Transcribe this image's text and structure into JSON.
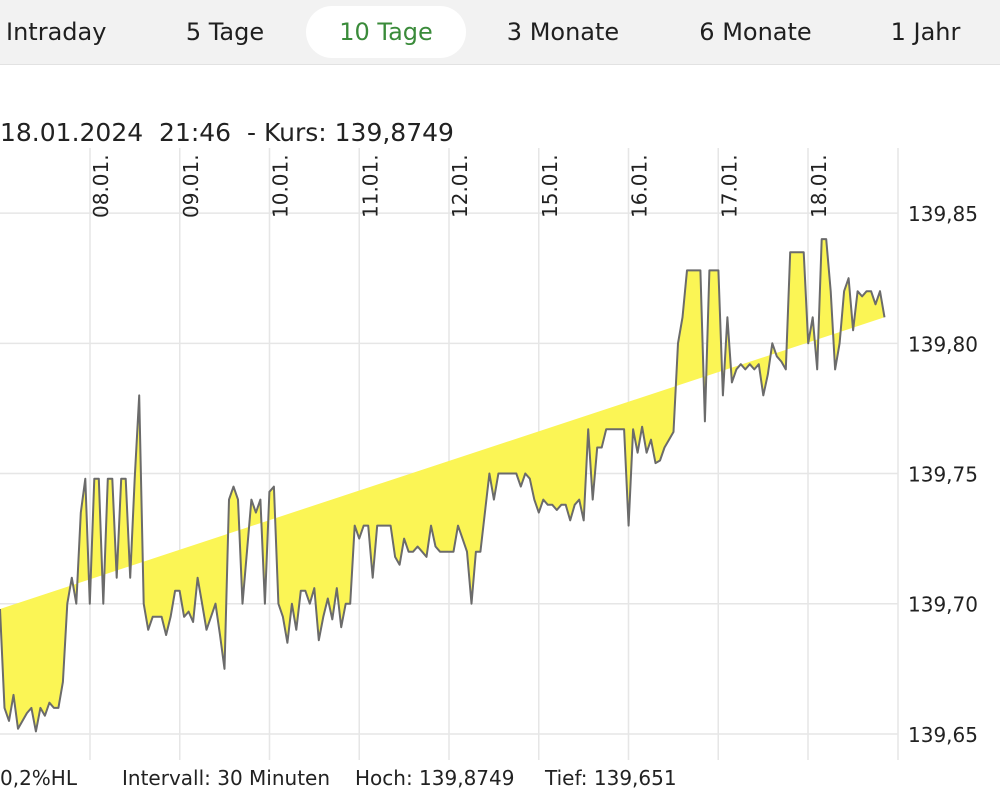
{
  "tabs": [
    {
      "label": "Intraday",
      "active": false
    },
    {
      "label": "5 Tage",
      "active": false
    },
    {
      "label": "10 Tage",
      "active": true
    },
    {
      "label": "3 Monate",
      "active": false
    },
    {
      "label": "6 Monate",
      "active": false
    },
    {
      "label": "1 Jahr",
      "active": false
    }
  ],
  "header": {
    "date": "18.01.2024",
    "time": "21:46",
    "price_label": "- Kurs: 139,8749"
  },
  "footer": {
    "indicator": "0,2%HL",
    "interval": "Intervall: 30 Minuten",
    "high": "Hoch: 139,8749",
    "low": "Tief:  139,651"
  },
  "colors": {
    "area_fill": "#fbf555",
    "line": "#6b6b6b",
    "grid": "#e6e6e6",
    "active_tab_text": "#3a8b3a"
  },
  "chart_data": {
    "type": "area",
    "ylim": [
      139.64,
      139.875
    ],
    "y_ticks": [
      139.65,
      139.7,
      139.75,
      139.8,
      139.85
    ],
    "y_tick_labels": [
      "139,65",
      "139,70",
      "139,75",
      "139,80",
      "139,85"
    ],
    "date_labels": [
      "08.01.",
      "09.01.",
      "10.01.",
      "11.01.",
      "12.01.",
      "15.01.",
      "16.01.",
      "17.01.",
      "18.01."
    ],
    "x": [
      0,
      0.5,
      1,
      1.5,
      2,
      3,
      3.5,
      4,
      4.5,
      5,
      5.5,
      6,
      6.5,
      7,
      7.5,
      8,
      8.5,
      9,
      9.5,
      10,
      10.5,
      11,
      11.5,
      12,
      12.5,
      13,
      13.5,
      14,
      14.5,
      15,
      15.5,
      16,
      16.5,
      17,
      18,
      18.5,
      19,
      19.5,
      20,
      20.5,
      21,
      21.5,
      22,
      22.5,
      23,
      23.5,
      24,
      24.5,
      25,
      25.5,
      26,
      26.5,
      27,
      28,
      28.5,
      29,
      29.5,
      30,
      30.5,
      31,
      31.5,
      32,
      32.5,
      33,
      33.5,
      34,
      34.5,
      35,
      35.5,
      36,
      36.5,
      37,
      37.5,
      38,
      38.5,
      39,
      39.5,
      40,
      40.5,
      41,
      41.5,
      42,
      42.5,
      43,
      43.5,
      44,
      44.5,
      45,
      45.5,
      46,
      46.5,
      47,
      47.5,
      48,
      48.5,
      49,
      50,
      50.5,
      51,
      51.5,
      52,
      52.5,
      53,
      53.5,
      54,
      54.5,
      55,
      55.5,
      56,
      56.5,
      57,
      57.5,
      58,
      58.5,
      59,
      59.5,
      60,
      60.5,
      61,
      61.5,
      62,
      62.5,
      63,
      63.5,
      64,
      64.5,
      65,
      65.5,
      66,
      66.5,
      67,
      67.5,
      68,
      68.5,
      69,
      69.5,
      70,
      70.5,
      71,
      71.5,
      72,
      72.5,
      73,
      73.5,
      74,
      74.5,
      75,
      75.5,
      76,
      76.5,
      77,
      77.5,
      78,
      78.5,
      79,
      79.5,
      80,
      80.5,
      81,
      81.5,
      82,
      82.5,
      83,
      83.5,
      84,
      84.5,
      85,
      85.5,
      86,
      86.5,
      87,
      87.5,
      88,
      88.5,
      89,
      89.5,
      90,
      90.5,
      91,
      91.5,
      92,
      92.5,
      93,
      93.5,
      94,
      94.5,
      95,
      95.5,
      96,
      96.5,
      97,
      97.5,
      98,
      98.5,
      99,
      99.5,
      100
    ],
    "y": [
      139.698,
      139.66,
      139.655,
      139.665,
      139.652,
      139.658,
      139.66,
      139.651,
      139.66,
      139.657,
      139.662,
      139.66,
      139.66,
      139.67,
      139.7,
      139.71,
      139.7,
      139.735,
      139.748,
      139.7,
      139.748,
      139.748,
      139.7,
      139.748,
      139.748,
      139.71,
      139.748,
      139.748,
      139.71,
      139.748,
      139.78,
      139.7,
      139.69,
      139.695,
      139.695,
      139.688,
      139.695,
      139.705,
      139.705,
      139.695,
      139.697,
      139.693,
      139.71,
      139.7,
      139.69,
      139.695,
      139.7,
      139.688,
      139.675,
      139.74,
      139.745,
      139.74,
      139.7,
      139.74,
      139.735,
      139.74,
      139.7,
      139.743,
      139.745,
      139.7,
      139.695,
      139.685,
      139.7,
      139.69,
      139.705,
      139.705,
      139.7,
      139.706,
      139.686,
      139.695,
      139.702,
      139.694,
      139.706,
      139.691,
      139.7,
      139.7,
      139.73,
      139.725,
      139.73,
      139.73,
      139.71,
      139.73,
      139.73,
      139.73,
      139.73,
      139.718,
      139.715,
      139.725,
      139.72,
      139.72,
      139.722,
      139.72,
      139.718,
      139.73,
      139.722,
      139.72,
      139.72,
      139.72,
      139.73,
      139.725,
      139.72,
      139.7,
      139.72,
      139.72,
      139.735,
      139.75,
      139.74,
      139.75,
      139.75,
      139.75,
      139.75,
      139.75,
      139.745,
      139.75,
      139.748,
      139.74,
      139.735,
      139.74,
      139.738,
      139.738,
      139.736,
      139.738,
      139.738,
      139.732,
      139.738,
      139.74,
      139.732,
      139.767,
      139.74,
      139.76,
      139.76,
      139.767,
      139.767,
      139.767,
      139.767,
      139.767,
      139.73,
      139.767,
      139.758,
      139.768,
      139.758,
      139.763,
      139.754,
      139.755,
      139.76,
      139.763,
      139.766,
      139.8,
      139.81,
      139.828,
      139.828,
      139.828,
      139.828,
      139.77,
      139.828,
      139.828,
      139.828,
      139.78,
      139.81,
      139.785,
      139.79,
      139.792,
      139.79,
      139.792,
      139.79,
      139.792,
      139.78,
      139.788,
      139.8,
      139.795,
      139.793,
      139.79,
      139.835,
      139.835,
      139.835,
      139.835,
      139.8,
      139.81,
      139.79,
      139.84,
      139.84,
      139.82,
      139.79,
      139.8,
      139.82,
      139.825,
      139.805,
      139.82,
      139.818,
      139.82,
      139.82,
      139.815,
      139.82,
      139.81
    ]
  }
}
